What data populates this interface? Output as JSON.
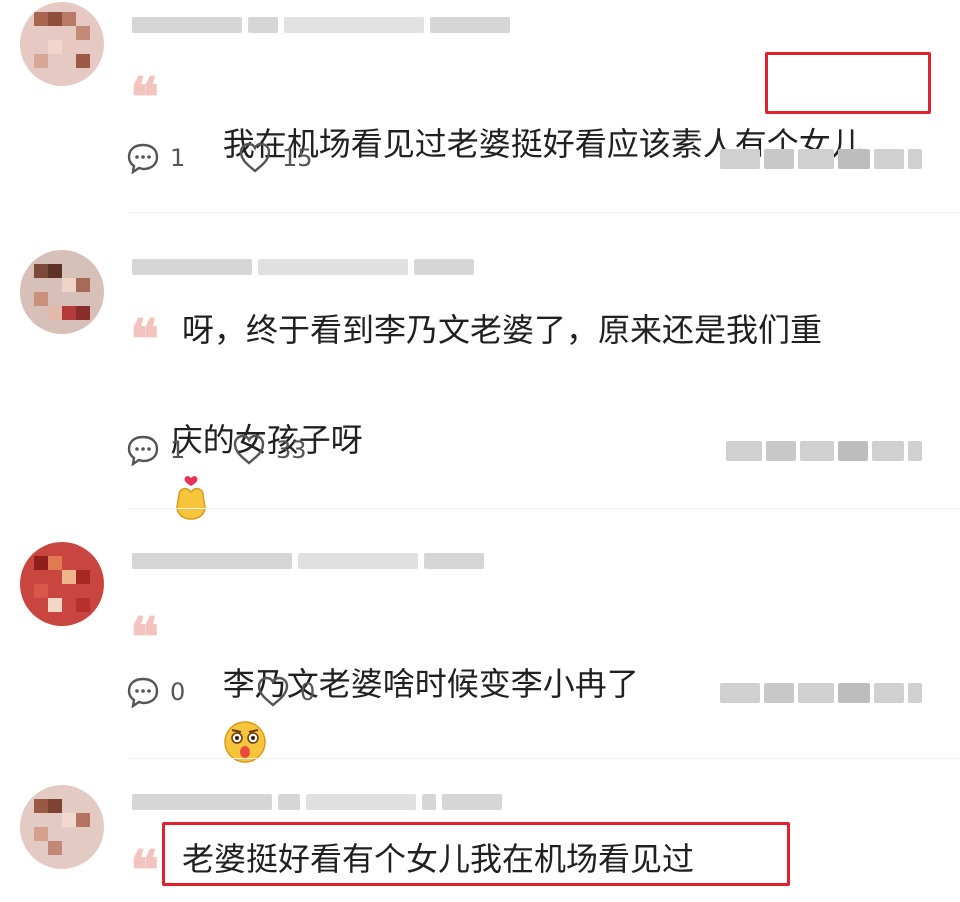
{
  "comments": [
    {
      "text": "我在机场看见过老婆挺好看应该素人",
      "highlight": "有个女儿",
      "reply_count": "1",
      "like_count": "15"
    },
    {
      "line1": "呀，终于看到李乃文老婆了，原来还是我们重",
      "line2": "庆的女孩子呀",
      "reply_count": "1",
      "like_count": "33"
    },
    {
      "text": "李乃文老婆啥时候变李小冉了",
      "reply_count": "0",
      "like_count": "0"
    },
    {
      "highlight": "老婆挺好看有个女儿我在机场看见过"
    }
  ],
  "quote_mark": "❝",
  "icons": {
    "reply": "comment-bubble-icon",
    "like": "heart-outline-icon",
    "emoji_heart_hands": "finger-heart-emoji",
    "emoji_shocked": "shocked-face-emoji"
  },
  "colors": {
    "highlight_border": "#e0212e",
    "quote_mark": "#f3c3c0",
    "text": "#202020",
    "meta": "#555555"
  }
}
